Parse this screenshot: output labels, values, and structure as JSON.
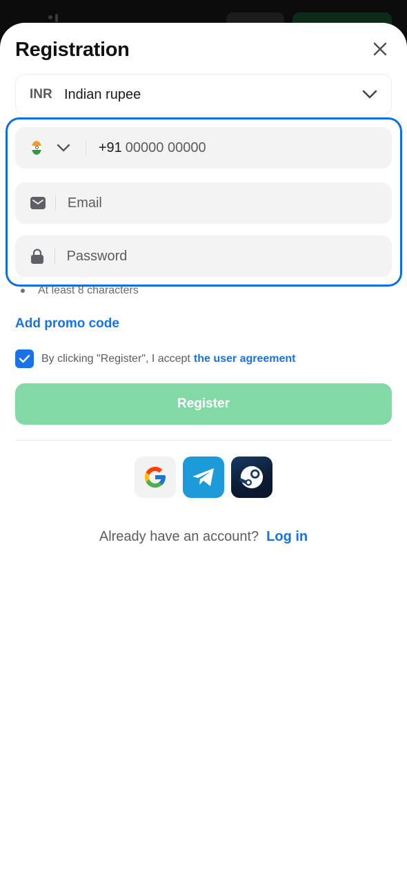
{
  "title": "Registration",
  "currency": {
    "code": "INR",
    "name": "Indian rupee"
  },
  "phone": {
    "country": "India",
    "dial_code": "+91",
    "placeholder": "00000 00000"
  },
  "email": {
    "placeholder": "Email"
  },
  "password": {
    "placeholder": "Password",
    "hint": "At least 8 characters"
  },
  "promo_link": "Add promo code",
  "agreement": {
    "checked": true,
    "text": "By clicking \"Register\", I accept",
    "link": "the user agreement"
  },
  "register_label": "Register",
  "social": [
    {
      "name": "Google",
      "icon": "google-icon"
    },
    {
      "name": "Telegram",
      "icon": "telegram-icon"
    },
    {
      "name": "Steam",
      "icon": "steam-icon"
    }
  ],
  "login": {
    "question": "Already have an account?",
    "link": "Log in"
  },
  "colors": {
    "accent": "#1673e6",
    "register_button": "#82d9a6",
    "highlight_frame": "#0b6fe3"
  }
}
